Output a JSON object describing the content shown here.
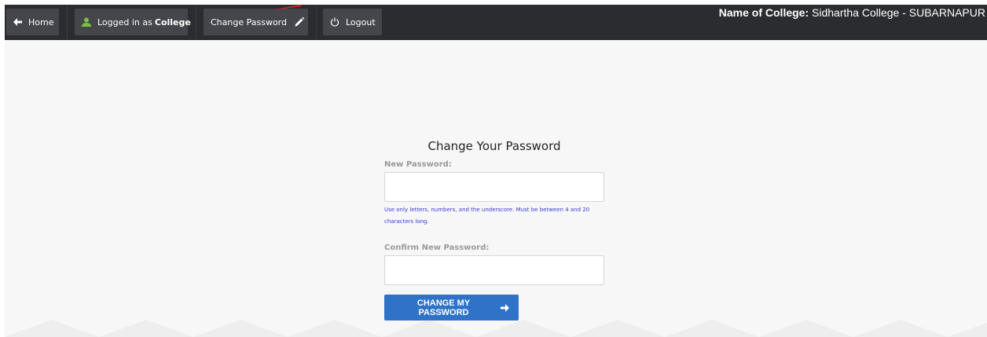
{
  "navbar": {
    "home_label": "Home",
    "logged_in_prefix": "Logged in as",
    "logged_in_role": "College",
    "change_password_label": "Change Password",
    "logout_label": "Logout",
    "college_name_label": "Name of College:",
    "college_name_value": "Sidhartha College - SUBARNAPUR"
  },
  "form": {
    "title": "Change Your Password",
    "new_password_label": "New Password:",
    "new_password_value": "",
    "hint": "Use only letters, numbers, and the underscore. Must be between 4 and 20 characters long.",
    "confirm_password_label": "Confirm New Password:",
    "confirm_password_value": "",
    "submit_label": "CHANGE MY PASSWORD"
  },
  "colors": {
    "navbar_bg": "#2a2c30",
    "nav_button_bg": "#44464b",
    "user_icon": "#7ac143",
    "hint_text": "#3a3ad8",
    "submit_bg": "#2f73c9",
    "pointer_arrow": "#e02020"
  },
  "icons": {
    "home": "arrow-left-icon",
    "user": "user-icon",
    "change_password": "pencil-icon",
    "logout": "power-icon",
    "submit": "arrow-right-icon"
  }
}
